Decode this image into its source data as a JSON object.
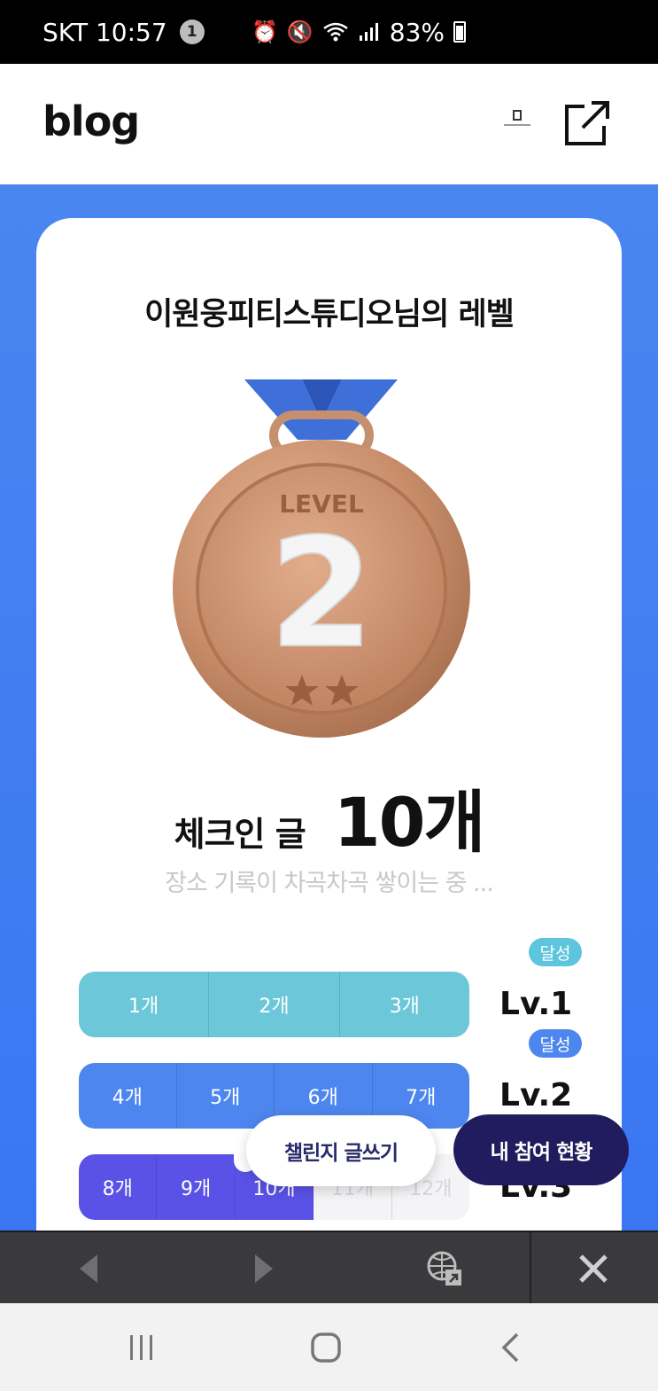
{
  "status_bar": {
    "carrier_time": "SKT 10:57",
    "notification_count": "1",
    "battery": "83%",
    "icons": [
      "alarm-icon",
      "mute-icon",
      "wifi-icon",
      "signal-icon",
      "battery-icon"
    ]
  },
  "header": {
    "logo": "blog",
    "icons": [
      "profile-thumbnail",
      "share-icon"
    ]
  },
  "card": {
    "title": "이원웅피티스튜디오님의 레벨",
    "medal": {
      "label": "LEVEL",
      "number": "2",
      "stars": 2
    },
    "count_label": "체크인 글",
    "count_value": "10개",
    "sub_text": "장소 기록이 차곡차곡 쌓이는 중 ..."
  },
  "levels": [
    {
      "label": "Lv.1",
      "badge": "달성",
      "segments": [
        "1개",
        "2개",
        "3개"
      ],
      "achieved": 3
    },
    {
      "label": "Lv.2",
      "badge": "달성",
      "segments": [
        "4개",
        "5개",
        "6개",
        "7개"
      ],
      "achieved": 4
    },
    {
      "label": "Lv.3",
      "badge": "",
      "segments": [
        "8개",
        "9개",
        "10개",
        "11개",
        "12개"
      ],
      "achieved": 3
    }
  ],
  "buttons": {
    "challenge": "챌린지 글쓰기",
    "status": "내 참여 현황"
  },
  "toolbar": {
    "icons": [
      "back-arrow-icon",
      "forward-arrow-icon",
      "open-in-browser-icon",
      "close-icon"
    ]
  },
  "nav": {
    "icons": [
      "recents-icon",
      "home-icon",
      "back-icon"
    ]
  },
  "colors": {
    "primary_blue": "#4a86f0",
    "lv1": "#6cc8d9",
    "lv2": "#4d86ee",
    "lv3": "#5a52e6",
    "status_button": "#211c5e"
  }
}
